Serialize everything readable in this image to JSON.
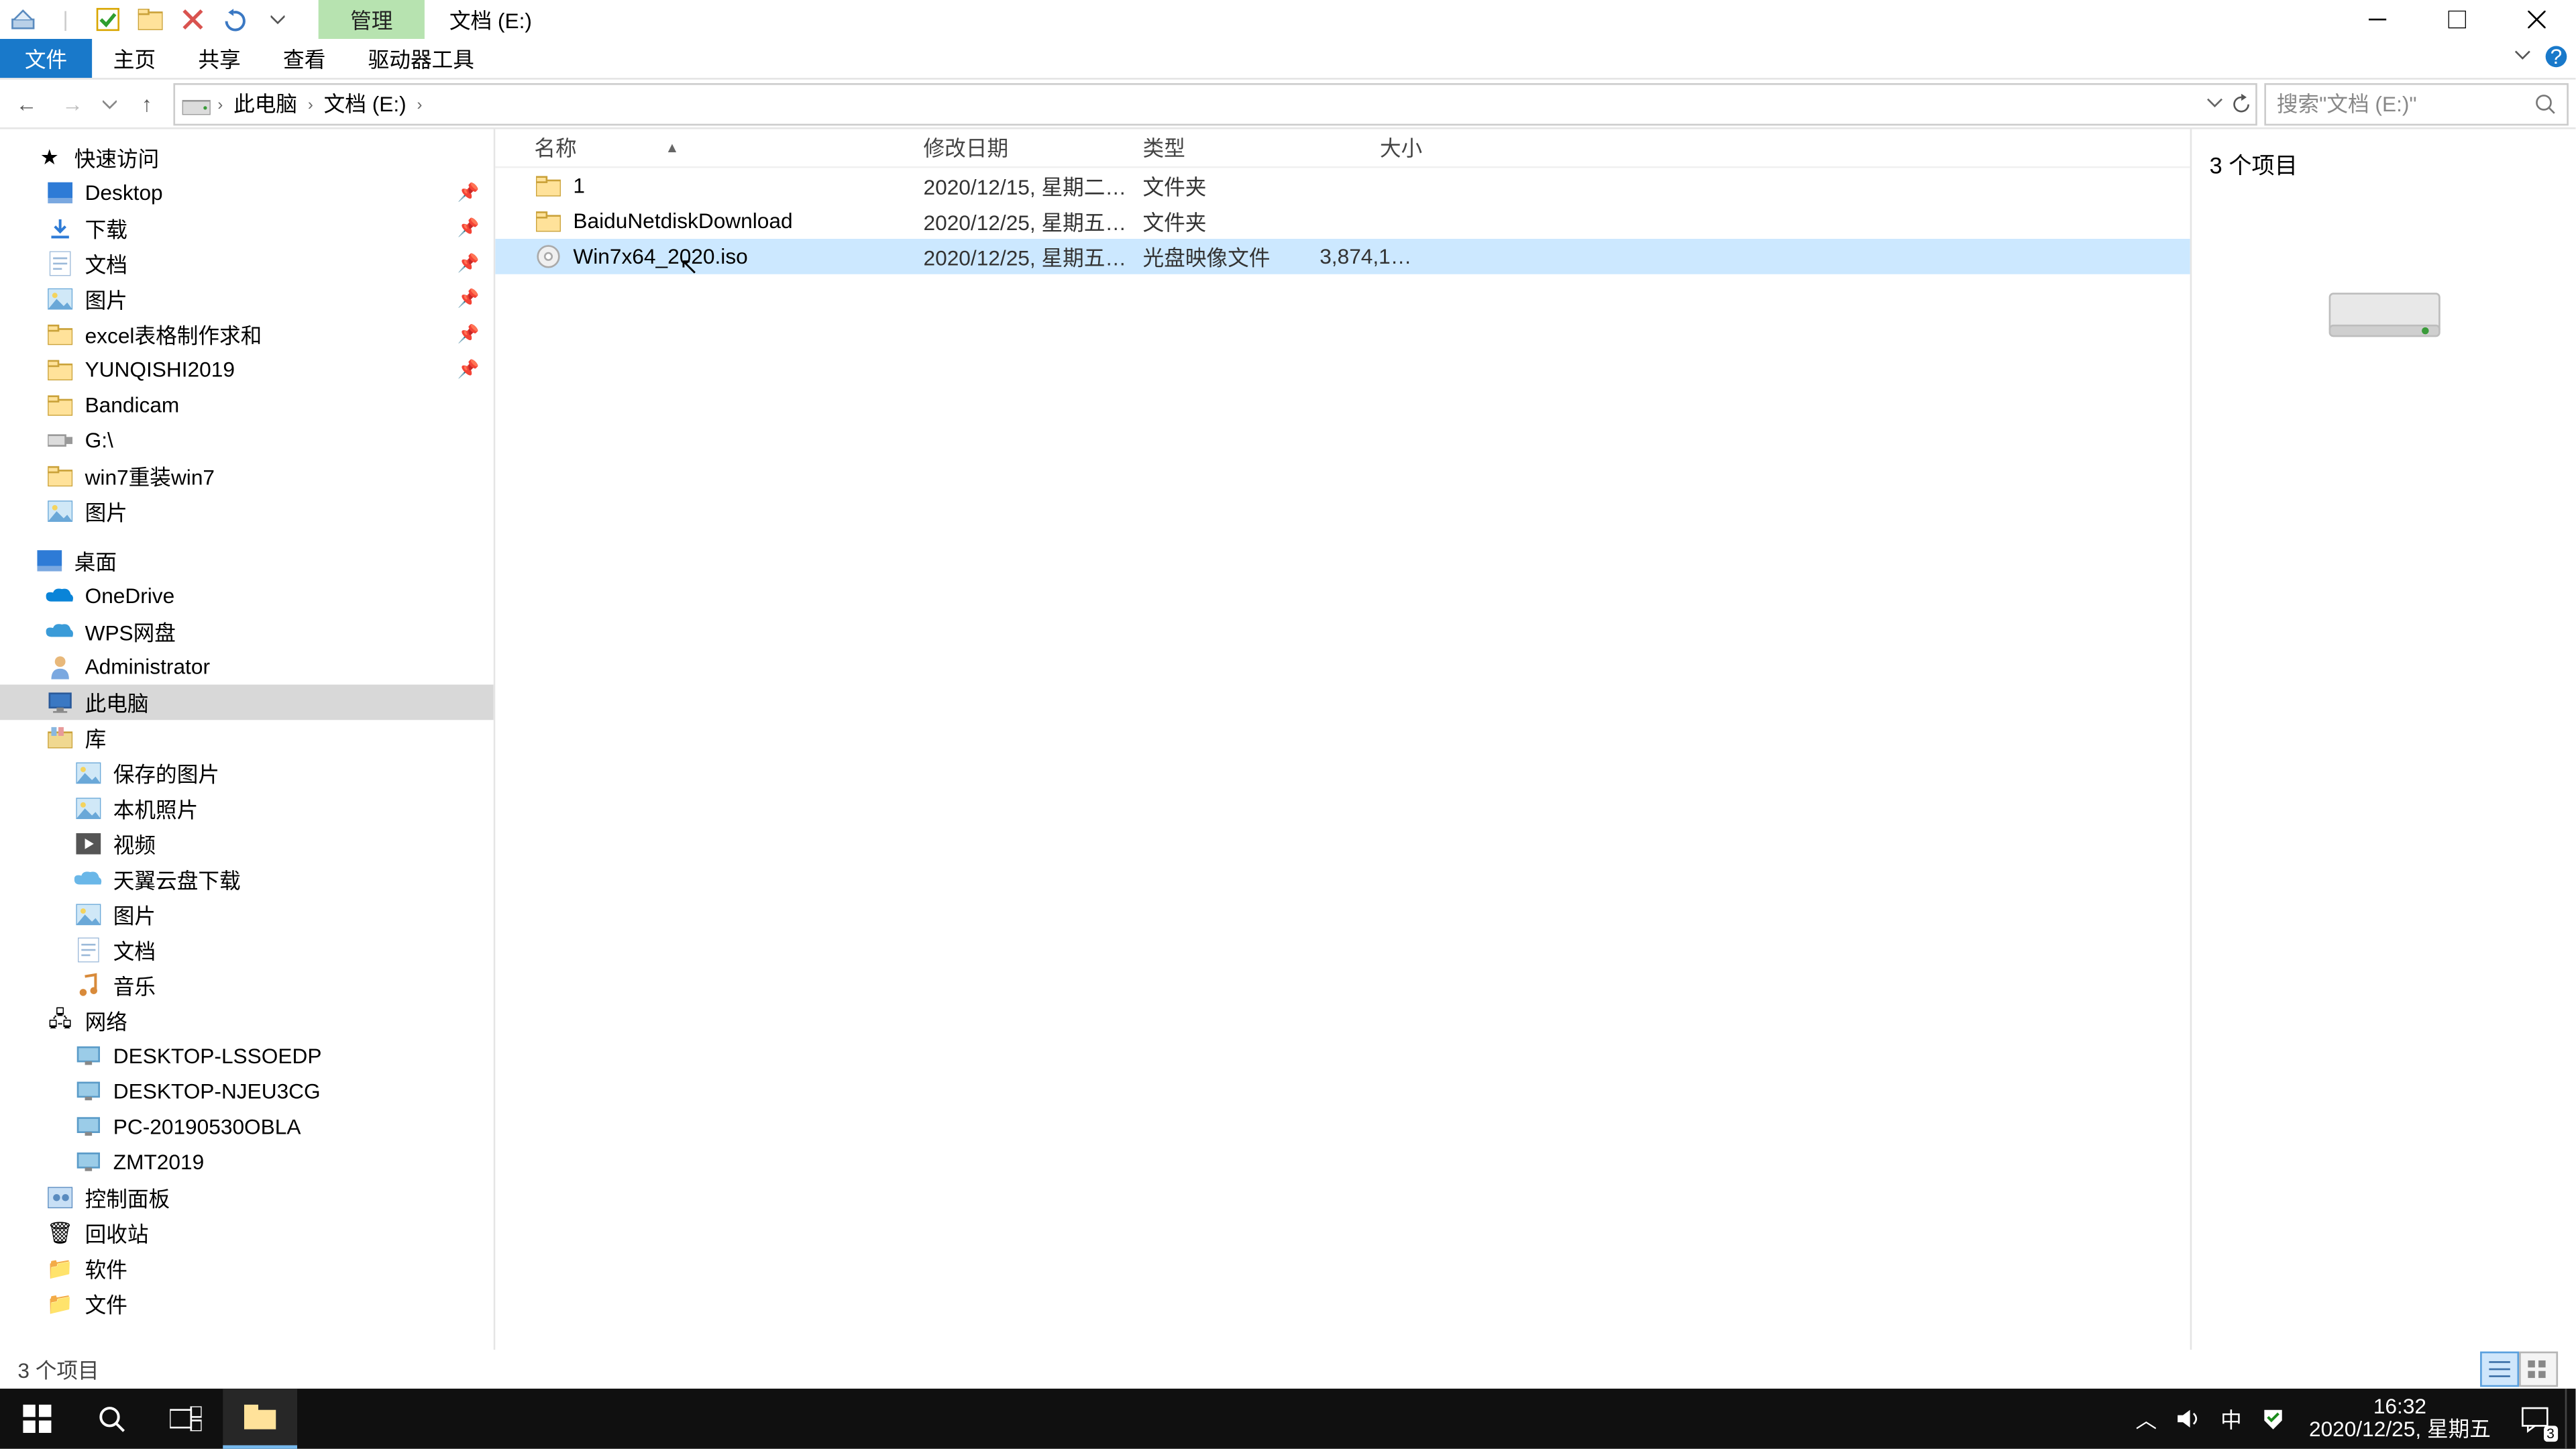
{
  "title": {
    "context_tab": "管理",
    "path_label": "文档 (E:)"
  },
  "ribbon": {
    "file": "文件",
    "home": "主页",
    "share": "共享",
    "view": "查看",
    "drive": "驱动器工具"
  },
  "breadcrumb": {
    "root": "此电脑",
    "drive": "文档 (E:)"
  },
  "search": {
    "placeholder": "搜索\"文档 (E:)\""
  },
  "columns": {
    "name": "名称",
    "date": "修改日期",
    "type": "类型",
    "size": "大小"
  },
  "rows": [
    {
      "icon": "folder",
      "name": "1",
      "date": "2020/12/15, 星期二 1...",
      "type": "文件夹",
      "size": "",
      "sel": false
    },
    {
      "icon": "folder",
      "name": "BaiduNetdiskDownload",
      "date": "2020/12/25, 星期五 1...",
      "type": "文件夹",
      "size": "",
      "sel": false
    },
    {
      "icon": "iso",
      "name": "Win7x64_2020.iso",
      "date": "2020/12/25, 星期五 1...",
      "type": "光盘映像文件",
      "size": "3,874,126...",
      "sel": true
    }
  ],
  "preview": {
    "count": "3 个项目"
  },
  "status": {
    "text": "3 个项目"
  },
  "tree": {
    "quick": "快速访问",
    "quick_items": [
      {
        "icon": "desktop",
        "label": "Desktop",
        "pin": true
      },
      {
        "icon": "download",
        "label": "下载",
        "pin": true
      },
      {
        "icon": "doc",
        "label": "文档",
        "pin": true
      },
      {
        "icon": "pic",
        "label": "图片",
        "pin": true
      },
      {
        "icon": "folder",
        "label": "excel表格制作求和",
        "pin": true
      },
      {
        "icon": "folder",
        "label": "YUNQISHI2019",
        "pin": true
      },
      {
        "icon": "folder",
        "label": "Bandicam",
        "pin": false
      },
      {
        "icon": "usb",
        "label": "G:\\",
        "pin": false
      },
      {
        "icon": "folder",
        "label": "win7重装win7",
        "pin": false
      },
      {
        "icon": "pic",
        "label": "图片",
        "pin": false
      }
    ],
    "desktop": "桌面",
    "desktop_items": [
      {
        "icon": "onedrive",
        "label": "OneDrive"
      },
      {
        "icon": "wps",
        "label": "WPS网盘"
      },
      {
        "icon": "user",
        "label": "Administrator"
      },
      {
        "icon": "pc",
        "label": "此电脑",
        "sel": true
      },
      {
        "icon": "lib",
        "label": "库"
      }
    ],
    "lib_items": [
      {
        "icon": "pic",
        "label": "保存的图片"
      },
      {
        "icon": "pic",
        "label": "本机照片"
      },
      {
        "icon": "video",
        "label": "视频"
      },
      {
        "icon": "cloud",
        "label": "天翼云盘下载"
      },
      {
        "icon": "pic",
        "label": "图片"
      },
      {
        "icon": "doc",
        "label": "文档"
      },
      {
        "icon": "music",
        "label": "音乐"
      }
    ],
    "network": "网络",
    "net_items": [
      {
        "icon": "netpc",
        "label": "DESKTOP-LSSOEDP"
      },
      {
        "icon": "netpc",
        "label": "DESKTOP-NJEU3CG"
      },
      {
        "icon": "netpc",
        "label": "PC-20190530OBLA"
      },
      {
        "icon": "netpc",
        "label": "ZMT2019"
      }
    ],
    "cpl": "控制面板",
    "recycle": "回收站",
    "soft": "软件",
    "files": "文件"
  },
  "taskbar": {
    "clock_time": "16:32",
    "clock_date": "2020/12/25, 星期五",
    "ime": "中",
    "notif_count": "3"
  }
}
